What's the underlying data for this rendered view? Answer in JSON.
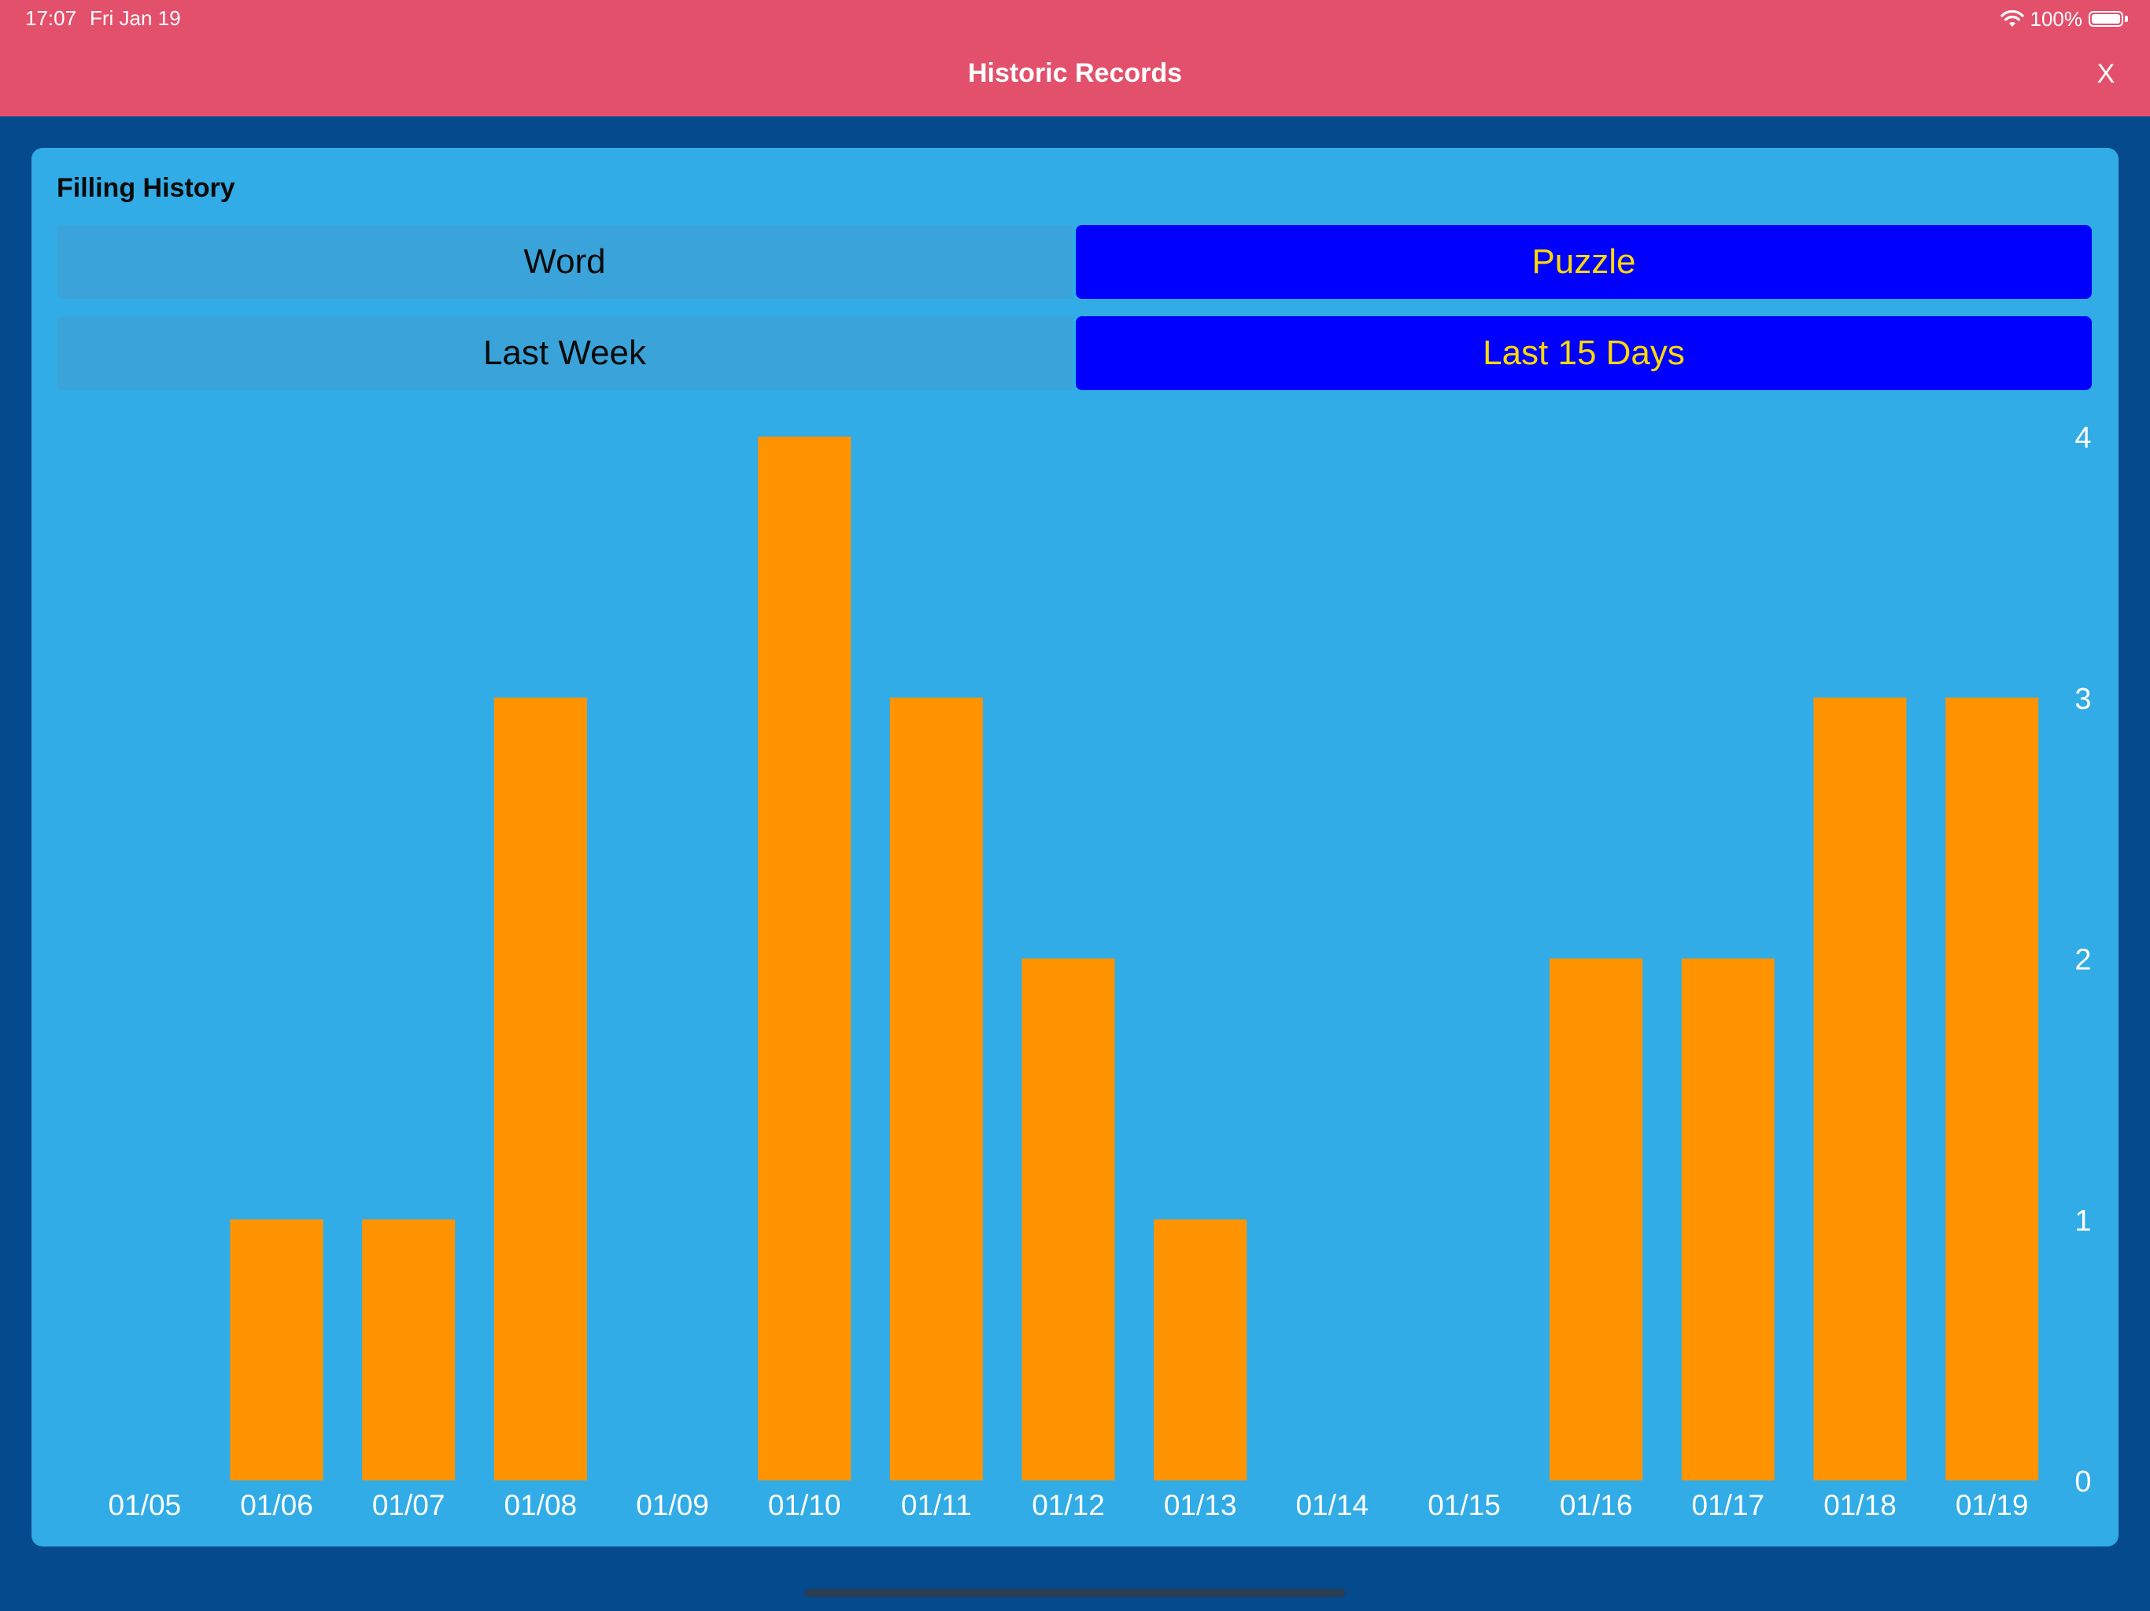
{
  "status_bar": {
    "time": "17:07",
    "date": "Fri Jan 19",
    "battery": "100%",
    "icons": [
      "wifi-icon",
      "battery-icon"
    ]
  },
  "nav": {
    "title": "Historic Records",
    "close_label": "X"
  },
  "card": {
    "title": "Filling History",
    "type_toggle": {
      "options": [
        "Word",
        "Puzzle"
      ],
      "selected": "Puzzle"
    },
    "range_toggle": {
      "options": [
        "Last Week",
        "Last 15 Days"
      ],
      "selected": "Last 15 Days"
    }
  },
  "colors": {
    "header": "#e3506c",
    "background": "#044a8c",
    "card": "#31ace6",
    "bar": "#ff9300",
    "selected_segment": "#0000ff",
    "selected_text": "#ffd900"
  },
  "chart_data": {
    "type": "bar",
    "categories": [
      "01/05",
      "01/06",
      "01/07",
      "01/08",
      "01/09",
      "01/10",
      "01/11",
      "01/12",
      "01/13",
      "01/14",
      "01/15",
      "01/16",
      "01/17",
      "01/18",
      "01/19"
    ],
    "values": [
      0,
      1,
      1,
      3,
      0,
      4,
      3,
      2,
      1,
      0,
      0,
      2,
      2,
      3,
      3
    ],
    "y_ticks": [
      0,
      1,
      2,
      3,
      4
    ],
    "ylim": [
      0,
      4
    ],
    "y_axis_side": "right",
    "grid": false,
    "legend": "none"
  }
}
